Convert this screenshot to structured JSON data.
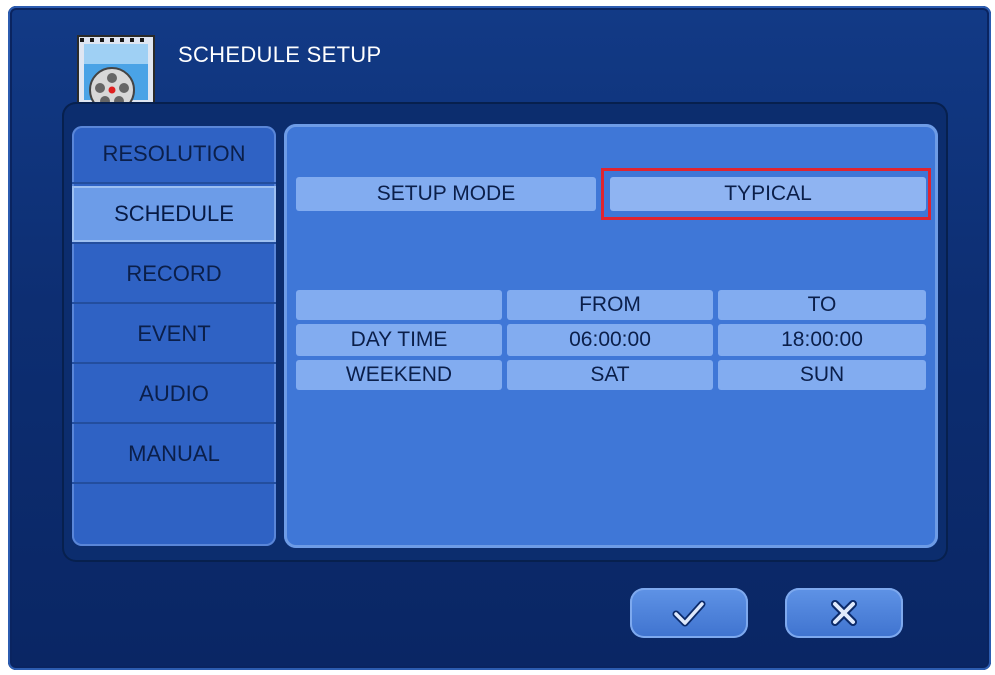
{
  "window": {
    "title": "SCHEDULE SETUP"
  },
  "sidebar": {
    "items": [
      {
        "label": "RESOLUTION"
      },
      {
        "label": "SCHEDULE"
      },
      {
        "label": "RECORD"
      },
      {
        "label": "EVENT"
      },
      {
        "label": "AUDIO"
      },
      {
        "label": "MANUAL"
      }
    ],
    "selected": "SCHEDULE"
  },
  "setup": {
    "label": "SETUP MODE",
    "value": "TYPICAL"
  },
  "table": {
    "headers": [
      "",
      "FROM",
      "TO"
    ],
    "rows": [
      {
        "label": "DAY TIME",
        "from": "06:00:00",
        "to": "18:00:00"
      },
      {
        "label": "WEEKEND",
        "from": "SAT",
        "to": "SUN"
      }
    ]
  },
  "footer": {
    "confirm_icon": "check-icon",
    "cancel_icon": "close-icon"
  },
  "colors": {
    "highlight": "#e0242f",
    "accent": "#3f77d7"
  }
}
